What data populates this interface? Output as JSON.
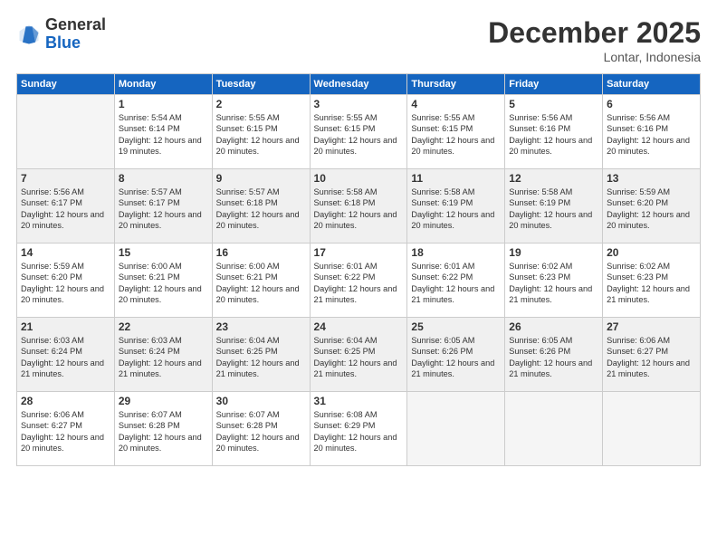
{
  "logo": {
    "line1": "General",
    "line2": "Blue"
  },
  "title": "December 2025",
  "location": "Lontar, Indonesia",
  "days_header": [
    "Sunday",
    "Monday",
    "Tuesday",
    "Wednesday",
    "Thursday",
    "Friday",
    "Saturday"
  ],
  "weeks": [
    {
      "shade": false,
      "days": [
        {
          "num": "",
          "sunrise": "",
          "sunset": "",
          "daylight": "",
          "empty": true
        },
        {
          "num": "1",
          "sunrise": "Sunrise: 5:54 AM",
          "sunset": "Sunset: 6:14 PM",
          "daylight": "Daylight: 12 hours and 19 minutes."
        },
        {
          "num": "2",
          "sunrise": "Sunrise: 5:55 AM",
          "sunset": "Sunset: 6:15 PM",
          "daylight": "Daylight: 12 hours and 20 minutes."
        },
        {
          "num": "3",
          "sunrise": "Sunrise: 5:55 AM",
          "sunset": "Sunset: 6:15 PM",
          "daylight": "Daylight: 12 hours and 20 minutes."
        },
        {
          "num": "4",
          "sunrise": "Sunrise: 5:55 AM",
          "sunset": "Sunset: 6:15 PM",
          "daylight": "Daylight: 12 hours and 20 minutes."
        },
        {
          "num": "5",
          "sunrise": "Sunrise: 5:56 AM",
          "sunset": "Sunset: 6:16 PM",
          "daylight": "Daylight: 12 hours and 20 minutes."
        },
        {
          "num": "6",
          "sunrise": "Sunrise: 5:56 AM",
          "sunset": "Sunset: 6:16 PM",
          "daylight": "Daylight: 12 hours and 20 minutes."
        }
      ]
    },
    {
      "shade": true,
      "days": [
        {
          "num": "7",
          "sunrise": "Sunrise: 5:56 AM",
          "sunset": "Sunset: 6:17 PM",
          "daylight": "Daylight: 12 hours and 20 minutes."
        },
        {
          "num": "8",
          "sunrise": "Sunrise: 5:57 AM",
          "sunset": "Sunset: 6:17 PM",
          "daylight": "Daylight: 12 hours and 20 minutes."
        },
        {
          "num": "9",
          "sunrise": "Sunrise: 5:57 AM",
          "sunset": "Sunset: 6:18 PM",
          "daylight": "Daylight: 12 hours and 20 minutes."
        },
        {
          "num": "10",
          "sunrise": "Sunrise: 5:58 AM",
          "sunset": "Sunset: 6:18 PM",
          "daylight": "Daylight: 12 hours and 20 minutes."
        },
        {
          "num": "11",
          "sunrise": "Sunrise: 5:58 AM",
          "sunset": "Sunset: 6:19 PM",
          "daylight": "Daylight: 12 hours and 20 minutes."
        },
        {
          "num": "12",
          "sunrise": "Sunrise: 5:58 AM",
          "sunset": "Sunset: 6:19 PM",
          "daylight": "Daylight: 12 hours and 20 minutes."
        },
        {
          "num": "13",
          "sunrise": "Sunrise: 5:59 AM",
          "sunset": "Sunset: 6:20 PM",
          "daylight": "Daylight: 12 hours and 20 minutes."
        }
      ]
    },
    {
      "shade": false,
      "days": [
        {
          "num": "14",
          "sunrise": "Sunrise: 5:59 AM",
          "sunset": "Sunset: 6:20 PM",
          "daylight": "Daylight: 12 hours and 20 minutes."
        },
        {
          "num": "15",
          "sunrise": "Sunrise: 6:00 AM",
          "sunset": "Sunset: 6:21 PM",
          "daylight": "Daylight: 12 hours and 20 minutes."
        },
        {
          "num": "16",
          "sunrise": "Sunrise: 6:00 AM",
          "sunset": "Sunset: 6:21 PM",
          "daylight": "Daylight: 12 hours and 20 minutes."
        },
        {
          "num": "17",
          "sunrise": "Sunrise: 6:01 AM",
          "sunset": "Sunset: 6:22 PM",
          "daylight": "Daylight: 12 hours and 21 minutes."
        },
        {
          "num": "18",
          "sunrise": "Sunrise: 6:01 AM",
          "sunset": "Sunset: 6:22 PM",
          "daylight": "Daylight: 12 hours and 21 minutes."
        },
        {
          "num": "19",
          "sunrise": "Sunrise: 6:02 AM",
          "sunset": "Sunset: 6:23 PM",
          "daylight": "Daylight: 12 hours and 21 minutes."
        },
        {
          "num": "20",
          "sunrise": "Sunrise: 6:02 AM",
          "sunset": "Sunset: 6:23 PM",
          "daylight": "Daylight: 12 hours and 21 minutes."
        }
      ]
    },
    {
      "shade": true,
      "days": [
        {
          "num": "21",
          "sunrise": "Sunrise: 6:03 AM",
          "sunset": "Sunset: 6:24 PM",
          "daylight": "Daylight: 12 hours and 21 minutes."
        },
        {
          "num": "22",
          "sunrise": "Sunrise: 6:03 AM",
          "sunset": "Sunset: 6:24 PM",
          "daylight": "Daylight: 12 hours and 21 minutes."
        },
        {
          "num": "23",
          "sunrise": "Sunrise: 6:04 AM",
          "sunset": "Sunset: 6:25 PM",
          "daylight": "Daylight: 12 hours and 21 minutes."
        },
        {
          "num": "24",
          "sunrise": "Sunrise: 6:04 AM",
          "sunset": "Sunset: 6:25 PM",
          "daylight": "Daylight: 12 hours and 21 minutes."
        },
        {
          "num": "25",
          "sunrise": "Sunrise: 6:05 AM",
          "sunset": "Sunset: 6:26 PM",
          "daylight": "Daylight: 12 hours and 21 minutes."
        },
        {
          "num": "26",
          "sunrise": "Sunrise: 6:05 AM",
          "sunset": "Sunset: 6:26 PM",
          "daylight": "Daylight: 12 hours and 21 minutes."
        },
        {
          "num": "27",
          "sunrise": "Sunrise: 6:06 AM",
          "sunset": "Sunset: 6:27 PM",
          "daylight": "Daylight: 12 hours and 21 minutes."
        }
      ]
    },
    {
      "shade": false,
      "days": [
        {
          "num": "28",
          "sunrise": "Sunrise: 6:06 AM",
          "sunset": "Sunset: 6:27 PM",
          "daylight": "Daylight: 12 hours and 20 minutes."
        },
        {
          "num": "29",
          "sunrise": "Sunrise: 6:07 AM",
          "sunset": "Sunset: 6:28 PM",
          "daylight": "Daylight: 12 hours and 20 minutes."
        },
        {
          "num": "30",
          "sunrise": "Sunrise: 6:07 AM",
          "sunset": "Sunset: 6:28 PM",
          "daylight": "Daylight: 12 hours and 20 minutes."
        },
        {
          "num": "31",
          "sunrise": "Sunrise: 6:08 AM",
          "sunset": "Sunset: 6:29 PM",
          "daylight": "Daylight: 12 hours and 20 minutes."
        },
        {
          "num": "",
          "sunrise": "",
          "sunset": "",
          "daylight": "",
          "empty": true
        },
        {
          "num": "",
          "sunrise": "",
          "sunset": "",
          "daylight": "",
          "empty": true
        },
        {
          "num": "",
          "sunrise": "",
          "sunset": "",
          "daylight": "",
          "empty": true
        }
      ]
    }
  ]
}
